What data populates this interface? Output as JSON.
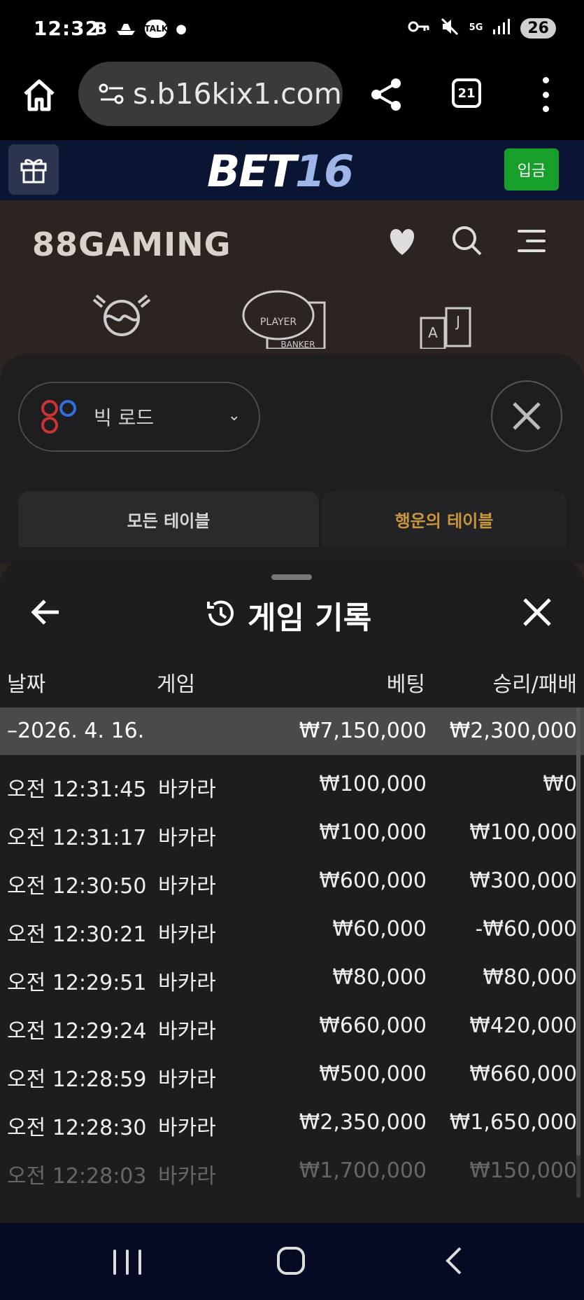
{
  "status_bar": {
    "time": "12:32",
    "left_icons": [
      "b-app-icon",
      "boat-icon",
      "talk-icon",
      "dot-icon"
    ],
    "talk_label": "TALK",
    "network_label": "5G",
    "battery": "26"
  },
  "browser": {
    "url": "s.b16kix1.com",
    "tab_count": "21"
  },
  "site_header": {
    "logo_bet": "BET",
    "logo_num": "16",
    "deposit_label": "입금"
  },
  "game_header": {
    "brand": "88GAMING",
    "player_label": "PLAYER",
    "banker_label": "BANKER",
    "card_a": "A",
    "card_j": "J"
  },
  "road_panel": {
    "select_label": "빅 로드",
    "tab_all": "모든 테이블",
    "tab_lucky": "행운의 테이블"
  },
  "history": {
    "title": "게임 기록",
    "columns": {
      "date": "날짜",
      "game": "게임",
      "bet": "베팅",
      "win_loss": "승리/패배"
    },
    "summary": {
      "date": "–2026. 4. 16.",
      "bet": "₩7,150,000",
      "win_loss": "₩2,300,000"
    },
    "rows": [
      {
        "date": "오전 12:31:45",
        "game": "바카라",
        "bet": "₩100,000",
        "win_loss": "₩0"
      },
      {
        "date": "오전 12:31:17",
        "game": "바카라",
        "bet": "₩100,000",
        "win_loss": "₩100,000"
      },
      {
        "date": "오전 12:30:50",
        "game": "바카라",
        "bet": "₩600,000",
        "win_loss": "₩300,000"
      },
      {
        "date": "오전 12:30:21",
        "game": "바카라",
        "bet": "₩60,000",
        "win_loss": "-₩60,000"
      },
      {
        "date": "오전 12:29:51",
        "game": "바카라",
        "bet": "₩80,000",
        "win_loss": "₩80,000"
      },
      {
        "date": "오전 12:29:24",
        "game": "바카라",
        "bet": "₩660,000",
        "win_loss": "₩420,000"
      },
      {
        "date": "오전 12:28:59",
        "game": "바카라",
        "bet": "₩500,000",
        "win_loss": "₩660,000"
      },
      {
        "date": "오전 12:28:30",
        "game": "바카라",
        "bet": "₩2,350,000",
        "win_loss": "₩1,650,000"
      },
      {
        "date": "오전 12:28:03",
        "game": "바카라",
        "bet": "₩1,700,000",
        "win_loss": "₩150,000"
      }
    ]
  },
  "colors": {
    "site_header_bg": "#0a1433",
    "deposit_green": "#16a02a",
    "lucky_tab_gold": "#c9963e",
    "sheet_bg": "#1d1d1e",
    "summary_row_bg": "#4a4a4a",
    "nav_bg": "#040b22"
  }
}
